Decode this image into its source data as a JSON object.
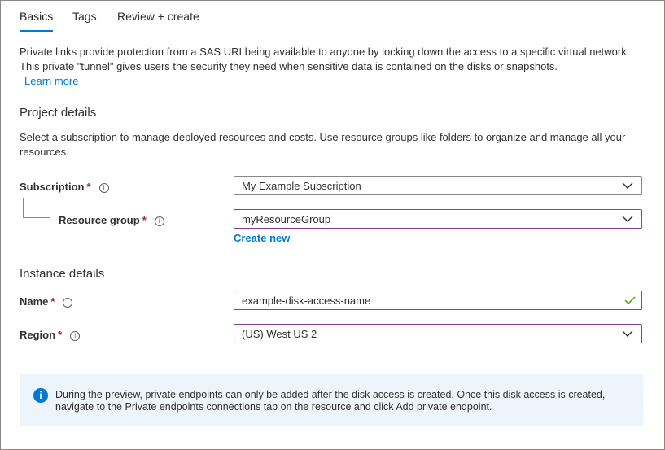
{
  "tabs": [
    {
      "label": "Basics",
      "active": true
    },
    {
      "label": "Tags",
      "active": false
    },
    {
      "label": "Review + create",
      "active": false
    }
  ],
  "intro": {
    "text": "Private links provide protection from a SAS URI being available to anyone by locking down the access to a specific virtual network. This private \"tunnel\" gives users the security they need when sensitive data is contained on the disks or snapshots.",
    "learn_more": "Learn more"
  },
  "project_details": {
    "title": "Project details",
    "description": "Select a subscription to manage deployed resources and costs. Use resource groups like folders to organize and manage all your resources.",
    "subscription": {
      "label": "Subscription",
      "required": "*",
      "value": "My Example Subscription"
    },
    "resource_group": {
      "label": "Resource group",
      "required": "*",
      "value": "myResourceGroup",
      "create_new": "Create new"
    }
  },
  "instance_details": {
    "title": "Instance details",
    "name": {
      "label": "Name",
      "required": "*",
      "value": "example-disk-access-name"
    },
    "region": {
      "label": "Region",
      "required": "*",
      "value": "(US) West US 2"
    }
  },
  "banner": {
    "icon": "info-icon",
    "text": "During the preview, private endpoints can only be added after the disk access is created. Once this disk access is created, navigate to the Private endpoints connections tab on the resource and click Add private endpoint."
  },
  "colors": {
    "accent": "#0078d4",
    "required": "#a4262c",
    "focus_border": "#8a3f8e",
    "valid": "#57a300",
    "banner_bg": "#eef4fb"
  }
}
